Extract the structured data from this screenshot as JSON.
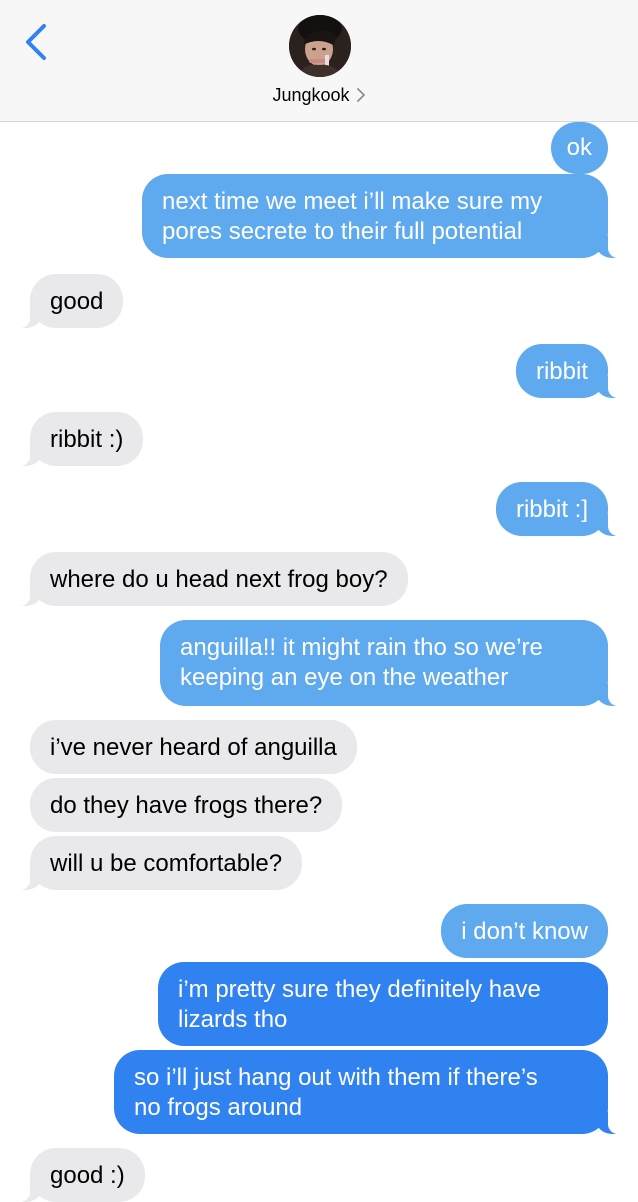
{
  "header": {
    "contact_name": "Jungkook",
    "back_icon": "chevron-left-icon",
    "details_icon": "chevron-right-icon",
    "accent_color": "#2f82f0"
  },
  "messages": [
    {
      "dir": "out",
      "text": "ok"
    },
    {
      "dir": "out",
      "lines": [
        "next time we meet i’ll make sure my",
        "pores secrete to their full potential"
      ]
    },
    {
      "dir": "in",
      "text": "good"
    },
    {
      "dir": "out",
      "text": "ribbit"
    },
    {
      "dir": "in",
      "text": "ribbit :)"
    },
    {
      "dir": "out",
      "text": "ribbit :]"
    },
    {
      "dir": "in",
      "text": "where do u head next frog boy?"
    },
    {
      "dir": "out",
      "lines": [
        "anguilla!! it might rain tho so we’re",
        "keeping an eye on the weather"
      ]
    },
    {
      "dir": "in",
      "text": "i’ve never heard of anguilla"
    },
    {
      "dir": "in",
      "text": "do they have frogs there?"
    },
    {
      "dir": "in",
      "text": "will u be comfortable?"
    },
    {
      "dir": "out",
      "text": "i don’t know"
    },
    {
      "dir": "out",
      "lines": [
        "i’m pretty sure they definitely have",
        "lizards tho"
      ]
    },
    {
      "dir": "out",
      "lines": [
        "so i’ll just hang out with them if there’s",
        "no frogs around"
      ]
    },
    {
      "dir": "in",
      "text": "good :)"
    }
  ],
  "colors": {
    "incoming_bubble": "#e9e9eb",
    "outgoing_bubble_light": "#5fa9ef",
    "outgoing_bubble_dark": "#2f82f0"
  }
}
